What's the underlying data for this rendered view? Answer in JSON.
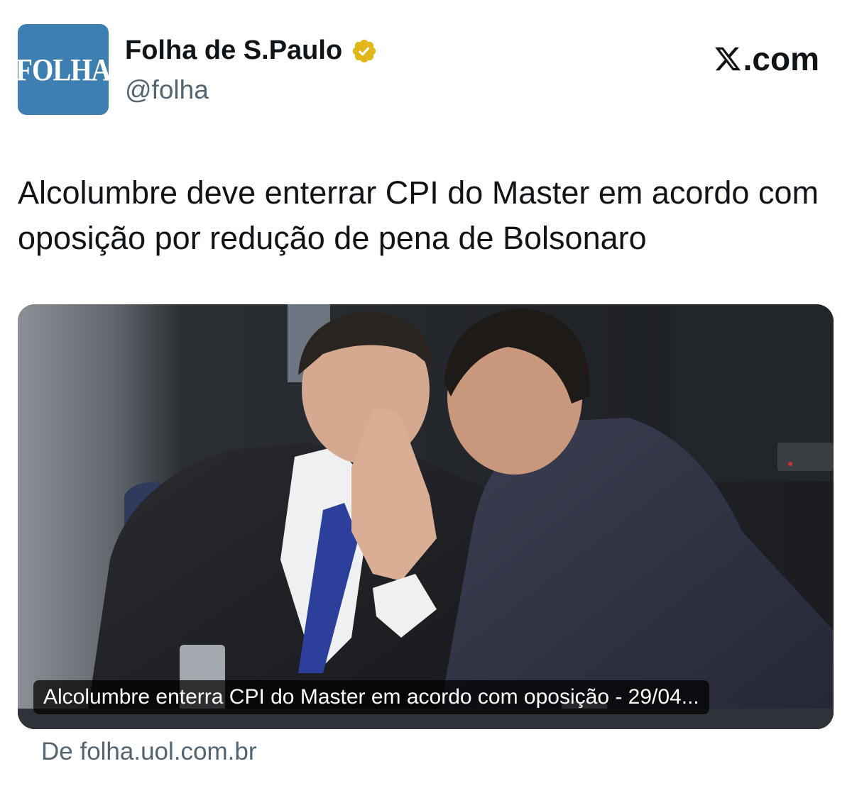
{
  "account": {
    "avatar_text": "FOLHA",
    "display_name": "Folha de S.Paulo",
    "handle": "@folha",
    "verified_badge_icon": "verified-badge-gold-icon"
  },
  "brand": {
    "logo_icon": "x-logo-icon",
    "text": ".com"
  },
  "tweet": {
    "text": "Alcolumbre deve enterrar CPI do Master em acordo com oposição por redução de pena de Bolsonaro"
  },
  "link_card": {
    "caption": "Alcolumbre enterra CPI do Master em acordo com oposição - 29/04...",
    "source": "De folha.uol.com.br"
  },
  "colors": {
    "avatar_bg": "#3c7fb0",
    "verified_gold": "#e2b719",
    "secondary_text": "#536471"
  }
}
